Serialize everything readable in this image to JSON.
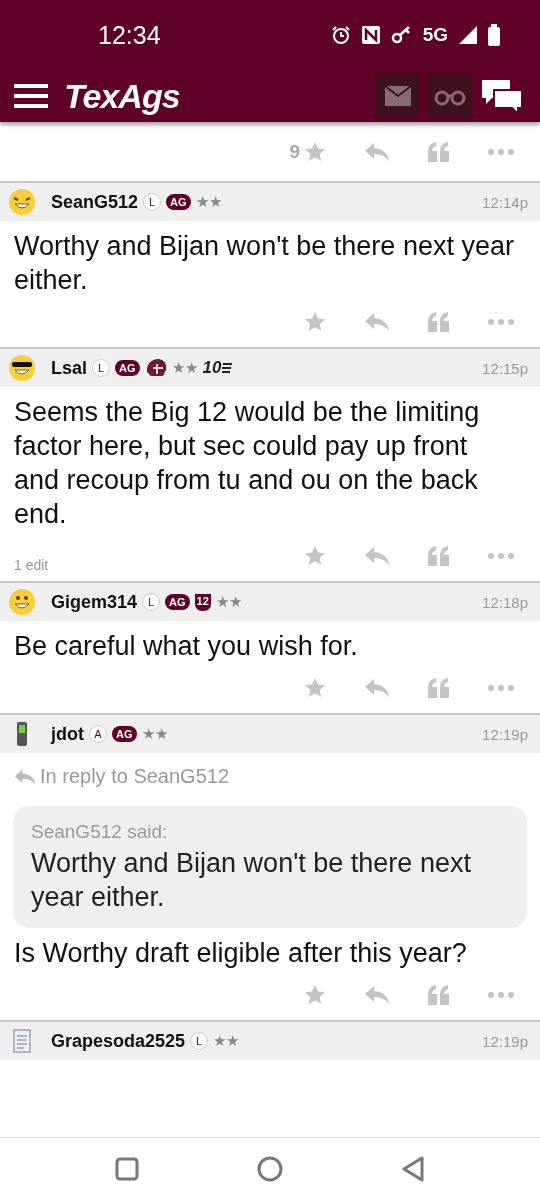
{
  "status_bar": {
    "time": "12:34",
    "network": "5G"
  },
  "app_bar": {
    "logo": "TexAgs"
  },
  "top_actions": {
    "star_count": "9"
  },
  "posts": [
    {
      "avatar": {
        "kind": "laughing"
      },
      "user": "SeanG512",
      "badges": [
        {
          "kind": "circle",
          "text": "L"
        },
        {
          "kind": "pill",
          "text": "AG"
        },
        {
          "kind": "stars",
          "text": "★★"
        }
      ],
      "time": "12:14p",
      "body": "Worthy and Bijan won't be there next year either."
    },
    {
      "avatar": {
        "kind": "cool"
      },
      "user": "Lsal",
      "badges": [
        {
          "kind": "circle",
          "text": "L"
        },
        {
          "kind": "pill",
          "text": "AG"
        },
        {
          "kind": "helmet"
        },
        {
          "kind": "stars",
          "text": "★★"
        },
        {
          "kind": "logo",
          "text": "10"
        }
      ],
      "time": "12:15p",
      "body": "Seems the Big 12 would be the limiting factor here, but sec could pay up front and recoup from tu and ou on the back end.",
      "edit_note": "1 edit"
    },
    {
      "avatar": {
        "kind": "smile"
      },
      "user": "Gigem314",
      "badges": [
        {
          "kind": "circle",
          "text": "L"
        },
        {
          "kind": "pill",
          "text": "AG"
        },
        {
          "kind": "shield",
          "text": "12"
        },
        {
          "kind": "stars",
          "text": "★★"
        }
      ],
      "time": "12:18p",
      "body": "Be careful what you wish for."
    },
    {
      "avatar": {
        "kind": "phone"
      },
      "user": "jdot",
      "badges": [
        {
          "kind": "circle",
          "text": "A"
        },
        {
          "kind": "pill",
          "text": "AG"
        },
        {
          "kind": "stars",
          "text": "★★"
        }
      ],
      "time": "12:19p",
      "reply_to": "In reply to SeanG512",
      "quote": {
        "author": "SeanG512 said:",
        "text": "Worthy and Bijan won't be there next year either."
      },
      "body": "Is Worthy draft eligible after this year?"
    },
    {
      "avatar": {
        "kind": "notepad"
      },
      "user": "Grapesoda2525",
      "badges": [
        {
          "kind": "circle",
          "text": "L"
        },
        {
          "kind": "stars",
          "text": "★★"
        }
      ],
      "time": "12:19p"
    }
  ]
}
